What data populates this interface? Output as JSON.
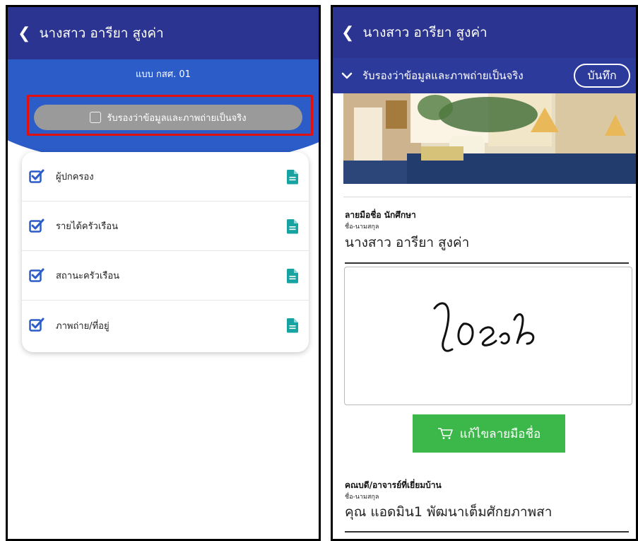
{
  "left": {
    "header": {
      "back_glyph": "❮",
      "title": "นางสาว อารียา สูงค่า"
    },
    "form_code": "แบบ กสศ. 01",
    "confirm_label": "รับรองว่าข้อมูลและภาพถ่ายเป็นจริง",
    "items": [
      {
        "label": "ผู้ปกครอง"
      },
      {
        "label": "รายได้ครัวเรือน"
      },
      {
        "label": "สถานะครัวเรือน"
      },
      {
        "label": "ภาพถ่าย/ที่อยู่"
      }
    ],
    "colors": {
      "header": "#2b3591",
      "accent": "#2c5cc8",
      "check": "#2c5cc8",
      "doc": "#18a3a3",
      "highlight": "#e01010"
    }
  },
  "right": {
    "header": {
      "back_glyph": "❮",
      "title": "นางสาว อารียา สูงค่า"
    },
    "confirm_label": "รับรองว่าข้อมูลและภาพถ่ายเป็นจริง",
    "save_label": "บันทึก",
    "student": {
      "heading": "ลายมือชื่อ นักศึกษา",
      "name_label": "ชื่อ-นามสกุล",
      "name_value": "นางสาว อารียา สูงค่า"
    },
    "edit_signature_label": "แก้ไขลายมือชื่อ",
    "teacher": {
      "heading": "คณบดี/อาจารย์ที่เยี่ยมบ้าน",
      "name_label": "ชื่อ-นามสกุล",
      "name_value": "คุณ แอดมิน1 พัฒนาเต็มศักยภาพสา"
    },
    "colors": {
      "green_button": "#3cb84a"
    }
  }
}
